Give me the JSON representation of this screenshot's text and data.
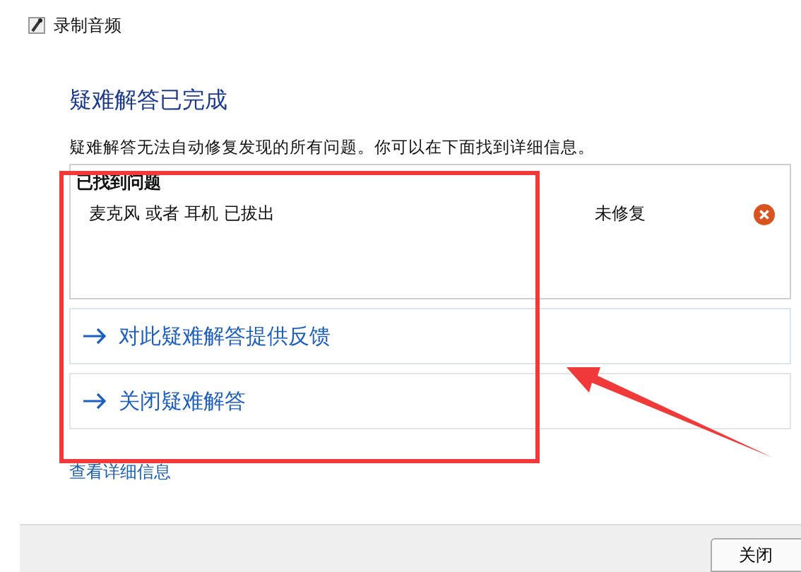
{
  "window": {
    "title": "录制音频"
  },
  "heading": "疑难解答已完成",
  "description": "疑难解答无法自动修复发现的所有问题。你可以在下面找到详细信息。",
  "problems": {
    "title": "已找到问题",
    "items": [
      {
        "name": "麦克风 或者 耳机 已拔出",
        "status": "未修复",
        "fixed": false
      }
    ]
  },
  "links": [
    {
      "label": "对此疑难解答提供反馈"
    },
    {
      "label": "关闭疑难解答"
    }
  ],
  "details_link": "查看详细信息",
  "buttons": [
    "关闭"
  ]
}
